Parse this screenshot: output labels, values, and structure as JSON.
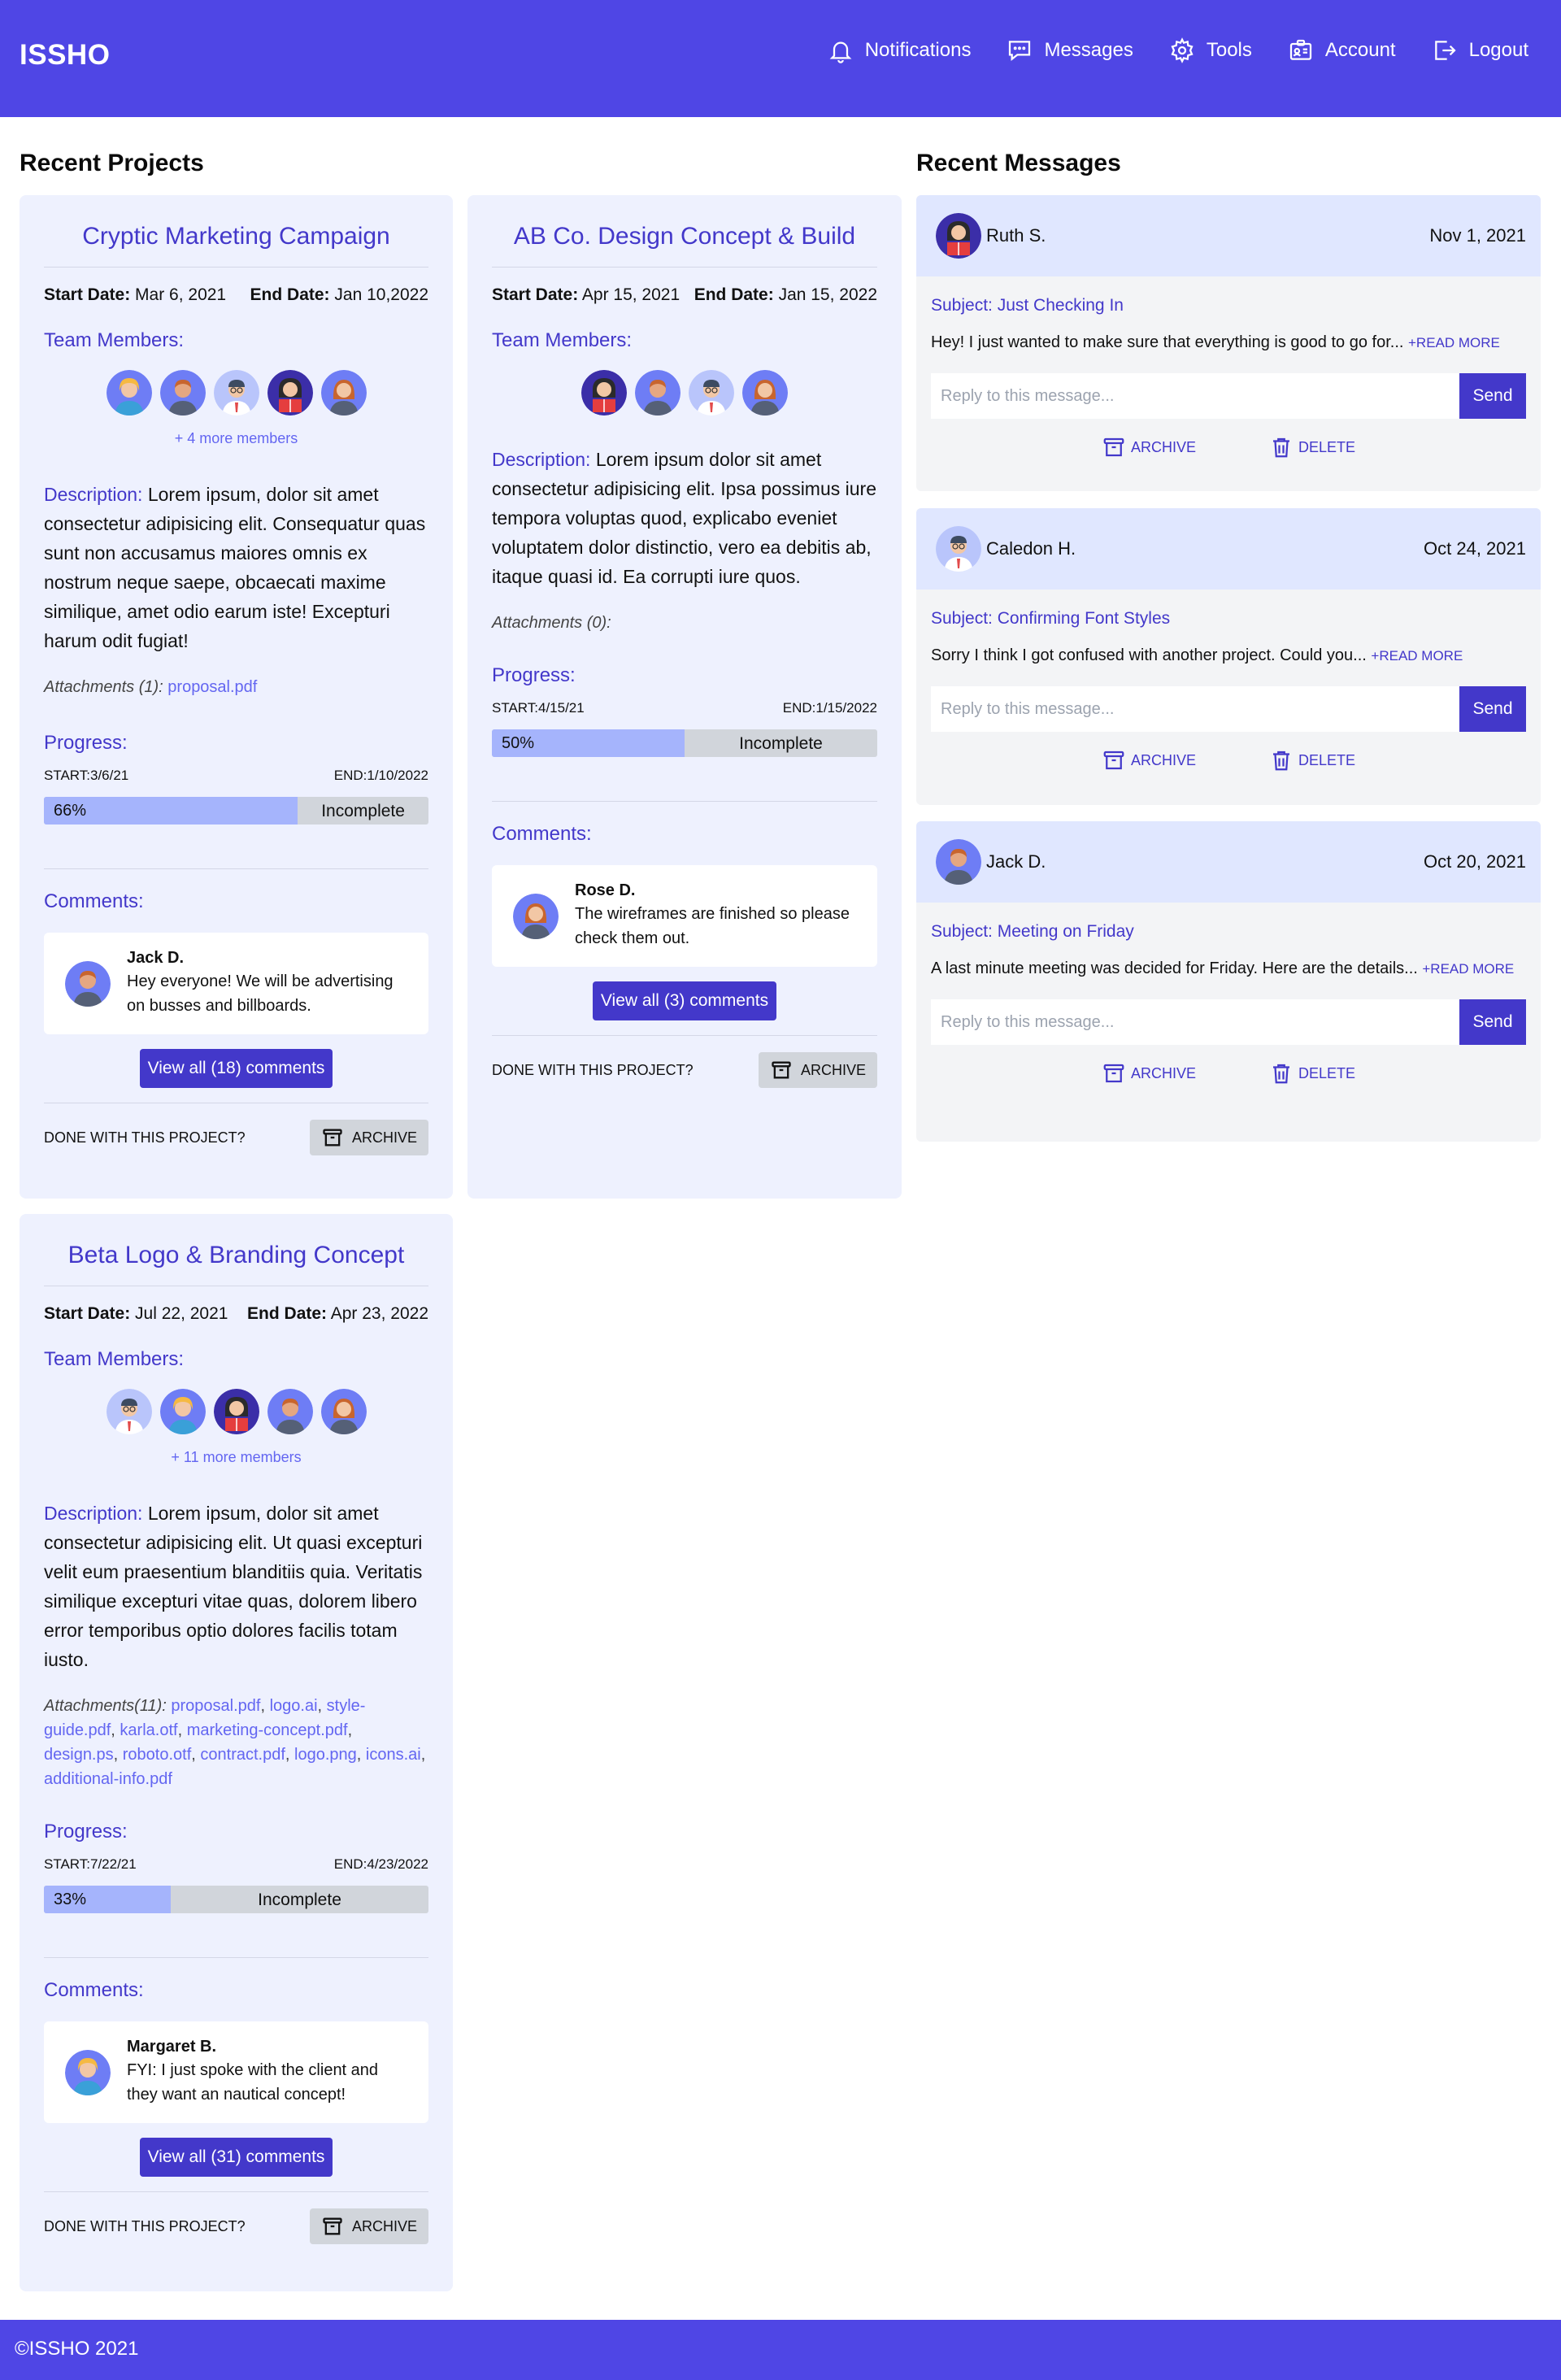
{
  "header": {
    "logo": "ISSHO",
    "nav": {
      "notifications": "Notifications",
      "messages": "Messages",
      "tools": "Tools",
      "account": "Account",
      "logout": "Logout"
    },
    "color": "#4f46e5"
  },
  "projects": {
    "section_title": "Recent Projects",
    "items": [
      {
        "title": "Cryptic Marketing Campaign",
        "start_label": "Start Date:",
        "start_date": "Mar 6, 2021",
        "end_label": "End Date:",
        "end_date": "Jan 10,2022",
        "team_label": "Team Members:",
        "more_members": "+ 4 more members",
        "desc_label": "Description:",
        "description": "Lorem ipsum, dolor sit amet consectetur adipisicing elit. Consequatur quas sunt non accusamus maiores omnis ex nostrum neque saepe, obcaecati maxime similique, amet odio earum iste! Excepturi harum odit fugiat!",
        "attachments_label": "Attachments (1):",
        "attachments": [
          "proposal.pdf"
        ],
        "progress_label": "Progress:",
        "progress_start": "START:3/6/21",
        "progress_end": "END:1/10/2022",
        "progress": 0.66,
        "progress_pct": "66%",
        "progress_status": "Incomplete",
        "comments_label": "Comments:",
        "comment_author": "Jack D.",
        "comment_text": "Hey everyone! We will be advertising on busses and billboards.",
        "view_comments": "View all (18) comments",
        "done_text": "DONE WITH THIS PROJECT?",
        "archive_label": "ARCHIVE"
      },
      {
        "title": "AB Co. Design Concept & Build",
        "start_label": "Start Date:",
        "start_date": "Apr 15, 2021",
        "end_label": "End Date:",
        "end_date": "Jan 15, 2022",
        "team_label": "Team Members:",
        "desc_label": "Description:",
        "description": "Lorem ipsum dolor sit amet consectetur adipisicing elit. Ipsa possimus iure tempora voluptas quod, explicabo eveniet voluptatem dolor distinctio, vero ea debitis ab, itaque quasi id. Ea corrupti iure quos.",
        "attachments_label": "Attachments (0):",
        "progress_label": "Progress:",
        "progress_start": "START:4/15/21",
        "progress_end": "END:1/15/2022",
        "progress": 0.5,
        "progress_pct": "50%",
        "progress_status": "Incomplete",
        "comments_label": "Comments:",
        "comment_author": "Rose D.",
        "comment_text": "The wireframes are finished so please check them out.",
        "view_comments": "View all (3) comments",
        "done_text": "DONE WITH THIS PROJECT?",
        "archive_label": "ARCHIVE"
      },
      {
        "title": "Beta Logo & Branding Concept",
        "start_label": "Start Date:",
        "start_date": "Jul 22, 2021",
        "end_label": "End Date:",
        "end_date": "Apr 23, 2022",
        "team_label": "Team Members:",
        "more_members": "+ 11 more members",
        "desc_label": "Description:",
        "description": "Lorem ipsum, dolor sit amet consectetur adipisicing elit. Ut quasi excepturi velit eum praesentium blanditiis quia. Veritatis similique excepturi vitae quas, dolorem libero error temporibus optio dolores facilis totam iusto.",
        "attachments_label": "Attachments(11):",
        "attachments": [
          "proposal.pdf",
          "logo.ai",
          "style-guide.pdf",
          "karla.otf",
          "marketing-concept.pdf",
          "design.ps",
          "roboto.otf",
          "contract.pdf",
          "logo.png",
          "icons.ai",
          "additional-info.pdf"
        ],
        "progress_label": "Progress:",
        "progress_start": "START:7/22/21",
        "progress_end": "END:4/23/2022",
        "progress": 0.33,
        "progress_pct": "33%",
        "progress_status": "Incomplete",
        "comments_label": "Comments:",
        "comment_author": "Margaret B.",
        "comment_text": "FYI: I just spoke with the client and they want an nautical concept!",
        "view_comments": "View all (31) comments",
        "done_text": "DONE WITH THIS PROJECT?",
        "archive_label": "ARCHIVE"
      }
    ]
  },
  "messages": {
    "section_title": "Recent Messages",
    "reply_placeholder": "Reply to this message...",
    "send_label": "Send",
    "archive_label": "ARCHIVE",
    "delete_label": "DELETE",
    "read_more": "+READ MORE",
    "items": [
      {
        "from": "Ruth S.",
        "date": "Nov 1, 2021",
        "subject": "Subject: Just Checking In",
        "text": "Hey! I just wanted to make sure that everything is good to go for..."
      },
      {
        "from": "Caledon H.",
        "date": "Oct 24, 2021",
        "subject": "Subject: Confirming Font Styles",
        "text": "Sorry I think I got confused with another project. Could you..."
      },
      {
        "from": "Jack D.",
        "date": "Oct 20, 2021",
        "subject": "Subject: Meeting on Friday",
        "text": "A last minute meeting was decided for Friday. Here are the details..."
      }
    ]
  },
  "footer": {
    "text": "©ISSHO 2021"
  }
}
